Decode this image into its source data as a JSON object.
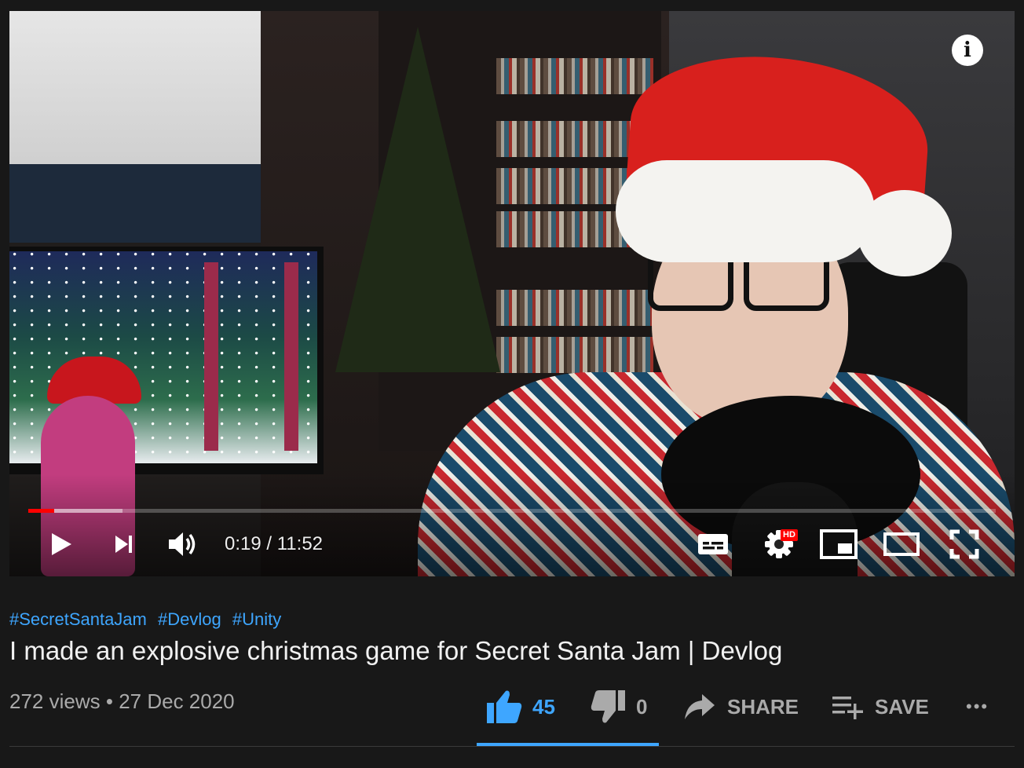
{
  "player": {
    "info_label": "i",
    "progress_played_fraction": 0.027,
    "progress_loaded_fraction": 0.097,
    "time_current": "0:19",
    "time_separator": " / ",
    "time_total": "11:52",
    "hd_badge": "HD",
    "icons": {
      "play": "play-icon",
      "next": "next-icon",
      "volume": "volume-icon",
      "subtitles": "subtitles-icon",
      "settings": "gear-icon",
      "miniplayer": "miniplayer-icon",
      "theater": "theater-icon",
      "fullscreen": "fullscreen-icon",
      "info": "info-icon"
    }
  },
  "video": {
    "hashtags": [
      "#SecretSantaJam",
      "#Devlog",
      "#Unity"
    ],
    "title": "I made an explosive christmas game for Secret Santa Jam | Devlog",
    "views": "272 views",
    "dot": "•",
    "date": "27 Dec 2020"
  },
  "actions": {
    "like_count": "45",
    "dislike_count": "0",
    "share_label": "SHARE",
    "save_label": "SAVE",
    "more_label": "•••"
  },
  "colors": {
    "accent_blue": "#3ea6ff",
    "progress_red": "#ff0000",
    "background": "#181818",
    "hd_badge": "#ff0000"
  }
}
